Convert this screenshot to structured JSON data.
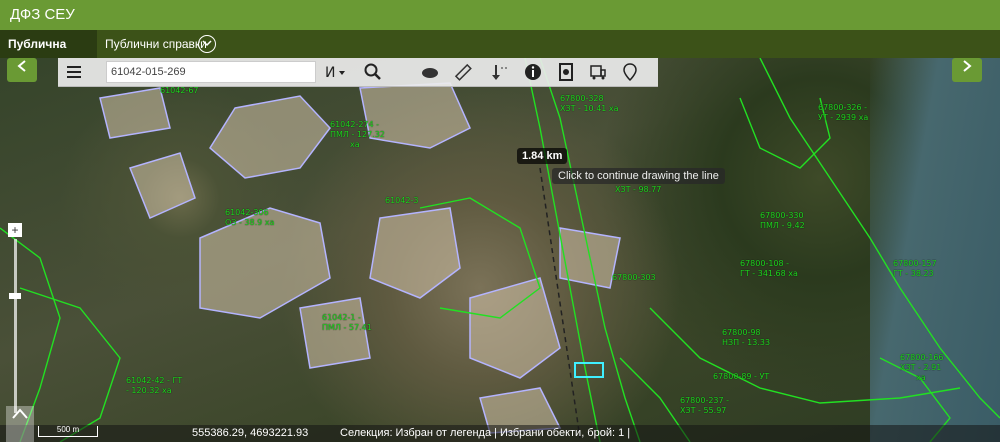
{
  "app": {
    "title": "ДФЗ СЕУ"
  },
  "nav": {
    "tab_map": "Публична карта",
    "tab_reports": "Публични справки"
  },
  "toolbar": {
    "search_value": "61042-015-269"
  },
  "map": {
    "measure_value": "1.84 km",
    "measure_hint": "Click to continue drawing the line",
    "scale_label": "500 m",
    "coords": "555386.29, 4693221.93",
    "selection_text": "Селекция: Избран от легенда  |  Избрани обекти, брой: 1  |",
    "parcel_labels": [
      "61042-67",
      "61042-274 -",
      "ПМЛ - 127.32",
      "ха",
      "67800-328",
      "ХЗТ - 10.41 ха",
      "67800-326 -",
      "УТ - 2939 ха",
      "61042-306",
      "ОЗ - 38.9 ха",
      "61042-3",
      "ХЗТ - 98.77",
      "67800-330",
      "ПМЛ - 9.42",
      "67800-108 -",
      "ГТ - 341.68 ха",
      "67800-157",
      "ГТ - 38.23",
      "61042-1 -",
      "ПМЛ - 57.41",
      "67800-98",
      "НЗП - 13.33",
      "67800-89 - УТ",
      "67800-237 -",
      "ХЗТ - 55.97",
      "61042-42 - ГТ",
      "- 120.32 ха",
      "67800-166",
      "ХЗТ - 2.91",
      "ха",
      "67800-303"
    ]
  },
  "colors": {
    "topbar": "#6a9a34",
    "navbar": "#3c5218",
    "parcel_outline": "#22e022",
    "selection_outline": "#b4b4ff"
  }
}
